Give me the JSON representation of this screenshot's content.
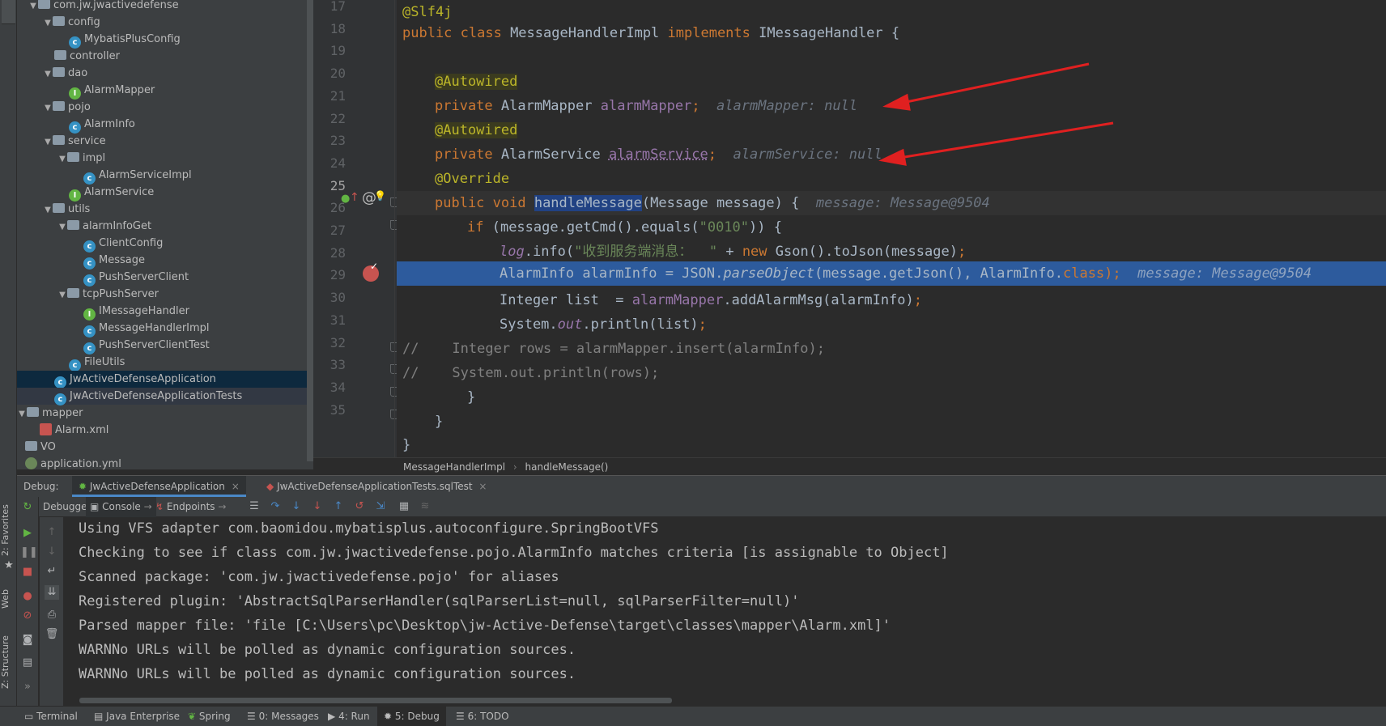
{
  "tool_windows_left": {
    "favorites": "2: Favorites",
    "web": "Web",
    "structure": "Z: Structure"
  },
  "project_tree": {
    "items": [
      {
        "label": "com.jw.jwactivedefense",
        "type": "folder"
      },
      {
        "label": "config",
        "type": "folder"
      },
      {
        "label": "MybatisPlusConfig",
        "type": "class"
      },
      {
        "label": "controller",
        "type": "folder"
      },
      {
        "label": "dao",
        "type": "folder"
      },
      {
        "label": "AlarmMapper",
        "type": "interface"
      },
      {
        "label": "pojo",
        "type": "folder"
      },
      {
        "label": "AlarmInfo",
        "type": "class"
      },
      {
        "label": "service",
        "type": "folder"
      },
      {
        "label": "impl",
        "type": "folder"
      },
      {
        "label": "AlarmServiceImpl",
        "type": "class"
      },
      {
        "label": "AlarmService",
        "type": "interface"
      },
      {
        "label": "utils",
        "type": "folder"
      },
      {
        "label": "alarmInfoGet",
        "type": "folder"
      },
      {
        "label": "ClientConfig",
        "type": "class"
      },
      {
        "label": "Message",
        "type": "class"
      },
      {
        "label": "PushServerClient",
        "type": "class"
      },
      {
        "label": "tcpPushServer",
        "type": "folder"
      },
      {
        "label": "IMessageHandler",
        "type": "interface"
      },
      {
        "label": "MessageHandlerImpl",
        "type": "class"
      },
      {
        "label": "PushServerClientTest",
        "type": "class"
      },
      {
        "label": "FileUtils",
        "type": "class"
      },
      {
        "label": "JwActiveDefenseApplication",
        "type": "class"
      },
      {
        "label": "JwActiveDefenseApplicationTests",
        "type": "class"
      },
      {
        "label": "mapper",
        "type": "folder"
      },
      {
        "label": "Alarm.xml",
        "type": "xml"
      },
      {
        "label": "VO",
        "type": "folder"
      },
      {
        "label": "application.yml",
        "type": "yml"
      }
    ]
  },
  "editor": {
    "line_numbers": [
      "17",
      "18",
      "19",
      "20",
      "21",
      "22",
      "23",
      "24",
      "25",
      "26",
      "27",
      "28",
      "29",
      "30",
      "31",
      "32",
      "33",
      "34",
      "35"
    ],
    "lines": {
      "l17": "@Slf4j",
      "l18a": "public class ",
      "l18b": "MessageHandlerImpl ",
      "l18c": "implements ",
      "l18d": "IMessageHandler {",
      "autowired": "@Autowired",
      "private": "private ",
      "alarmMapperType": "AlarmMapper ",
      "alarmMapperField": "alarmMapper",
      "semi": ";",
      "alarmMapperHint": "alarmMapper: null",
      "alarmServiceType": "AlarmService ",
      "alarmServiceField": "alarmService",
      "alarmServiceHint": "alarmService: null",
      "override": "@Override",
      "l25a": "public void ",
      "l25b": "handleMessage",
      "l25c": "(Message message) {",
      "l25hint": "message: Message@9504",
      "l26a": "if ",
      "l26b": "(message.getCmd().equals(",
      "l26c": "\"0010\"",
      "l26d": ")) {",
      "l27a": "log",
      "l27b": ".info(",
      "l27c": "\"收到服务端消息：  \"",
      "l27d": " + ",
      "l27e": "new ",
      "l27f": "Gson().toJson(message)",
      "l27g": ";",
      "l28a": "AlarmInfo alarmInfo = JSON.",
      "l28b": "parseObject",
      "l28c": "(message.getJson(), AlarmInfo.",
      "l28d": "class",
      "l28e": ");",
      "l28hint": "message: Message@9504",
      "l29a": "Integer list  = ",
      "l29b": "alarmMapper",
      "l29c": ".addAlarmMsg(alarmInfo)",
      "l29d": ";",
      "l30a": "System.",
      "l30b": "out",
      "l30c": ".println(list)",
      "l30d": ";",
      "l31": "//    Integer rows = alarmMapper.insert(alarmInfo);",
      "l32": "//    System.out.println(rows);",
      "l33": "}",
      "l34": "}",
      "l35": "}"
    }
  },
  "breadcrumb": {
    "class": "MessageHandlerImpl",
    "method": "handleMessage()"
  },
  "debug": {
    "label": "Debug:",
    "tabs": [
      "JwActiveDefenseApplication",
      "JwActiveDefenseApplicationTests.sqlTest"
    ],
    "toolbar": {
      "debugger": "Debugger",
      "console": "Console",
      "endpoints": "Endpoints"
    },
    "console_lines": [
      "Using VFS adapter com.baomidou.mybatisplus.autoconfigure.SpringBootVFS",
      "Checking to see if class com.jw.jwactivedefense.pojo.AlarmInfo matches criteria [is assignable to Object]",
      "Scanned package: 'com.jw.jwactivedefense.pojo' for aliases",
      "Registered plugin: 'AbstractSqlParserHandler(sqlParserList=null, sqlParserFilter=null)'",
      "Parsed mapper file: 'file [C:\\Users\\pc\\Desktop\\jw-Active-Defense\\target\\classes\\mapper\\Alarm.xml]'",
      "WARNNo URLs will be polled as dynamic configuration sources.",
      "WARNNo URLs will be polled as dynamic configuration sources."
    ]
  },
  "statusbar": {
    "terminal": "Terminal",
    "java_enterprise": "Java Enterprise",
    "spring": "Spring",
    "messages": "0: Messages",
    "run": "4: Run",
    "debug": "5: Debug",
    "todo": "6: TODO"
  },
  "colors": {
    "keyword": "#cc7832",
    "annotation": "#bbb529",
    "field": "#9876aa",
    "string": "#6a8759",
    "breakpoint_line": "#2d5b9d",
    "arrow": "#e02020"
  }
}
